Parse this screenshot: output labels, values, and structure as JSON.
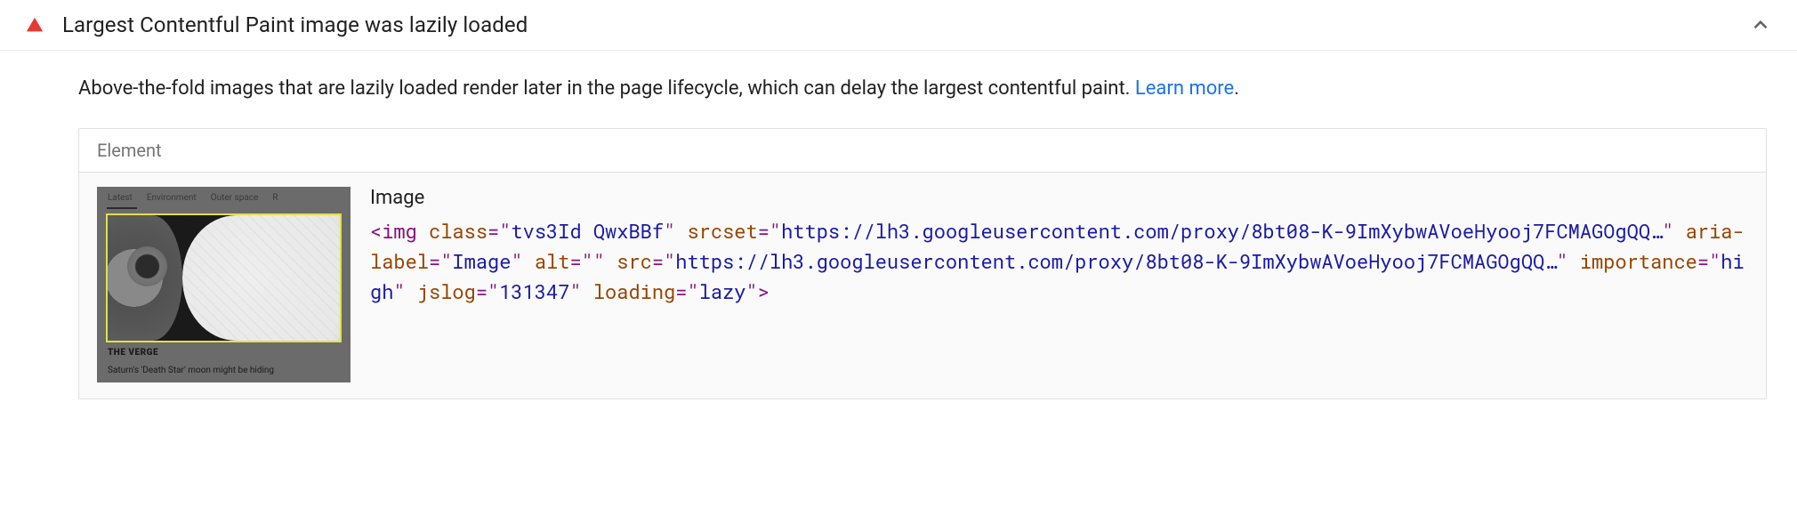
{
  "audit": {
    "title": "Largest Contentful Paint image was lazily loaded",
    "description_pre": "Above-the-fold images that are lazily loaded render later in the page lifecycle, which can delay the largest contentful paint. ",
    "learn_more": "Learn more",
    "description_post": "."
  },
  "table": {
    "header": "Element"
  },
  "node": {
    "label": "Image",
    "snippet": {
      "tag": "img",
      "attrs": [
        {
          "name": "class",
          "value": "tvs3Id QwxBBf"
        },
        {
          "name": "srcset",
          "value": "https://lh3.googleusercontent.com/proxy/8bt08-K-9ImXybwAVoeHyooj7FCMAGOgQQ…"
        },
        {
          "name": "aria-label",
          "value": "Image"
        },
        {
          "name": "alt",
          "value": ""
        },
        {
          "name": "src",
          "value": "https://lh3.googleusercontent.com/proxy/8bt08-K-9ImXybwAVoeHyooj7FCMAGOgQQ…"
        },
        {
          "name": "importance",
          "value": "high"
        },
        {
          "name": "jslog",
          "value": "131347"
        },
        {
          "name": "loading",
          "value": "lazy"
        }
      ]
    }
  },
  "thumb": {
    "nav": [
      "Latest",
      "Environment",
      "Outer space",
      "R"
    ],
    "source": "THE VERGE",
    "caption": "Saturn's 'Death Star' moon might be hiding"
  }
}
